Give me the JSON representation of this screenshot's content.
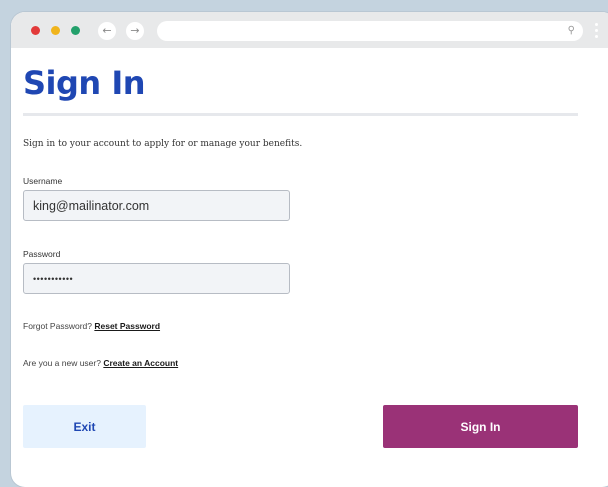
{
  "page": {
    "title": "Sign In",
    "intro": "Sign in to your account to apply for or manage your benefits."
  },
  "browser": {
    "back_icon": "←",
    "forward_icon": "→",
    "search_icon": "🔍"
  },
  "form": {
    "username_label": "Username",
    "username_value": "king@mailinator.com",
    "password_label": "Password",
    "password_value": "•••••••••••",
    "forgot_text": "Forgot Password?",
    "reset_link": "Reset Password",
    "new_user_text": "Are you a new user?",
    "create_link": "Create an Account"
  },
  "actions": {
    "exit_label": "Exit",
    "signin_label": "Sign In"
  },
  "colors": {
    "title": "#1f47b3",
    "primary_button": "#9a3277",
    "secondary_button": "#e6f2fe"
  }
}
